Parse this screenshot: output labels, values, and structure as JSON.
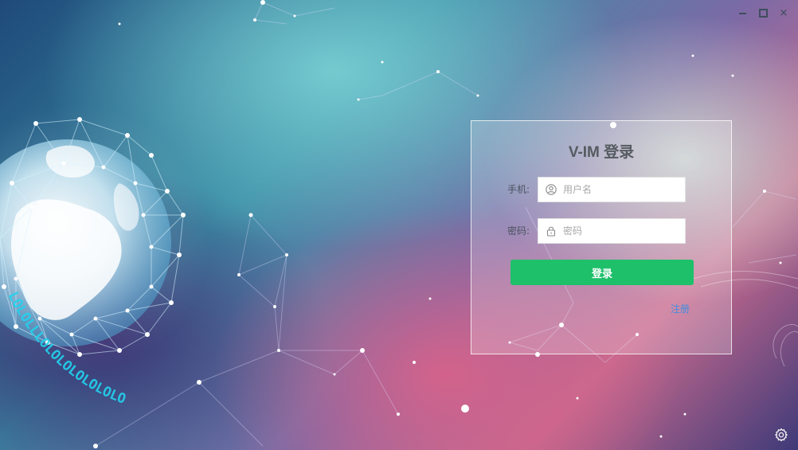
{
  "window": {
    "controls": {
      "minimize_icon": "minimize-icon",
      "maximize_icon": "maximize-icon",
      "close_symbol": "×"
    }
  },
  "login": {
    "title": "V-IM 登录",
    "phone_label": "手机:",
    "phone_placeholder": "用户名",
    "phone_value": "",
    "password_label": "密码:",
    "password_placeholder": "密码",
    "password_value": "",
    "submit_label": "登录",
    "register_label": "注册"
  },
  "background": {
    "binary_text": "LOLOLLLOLOLOLOLOLOLO"
  },
  "colors": {
    "accent_green": "#1ec06a",
    "link_blue": "#3f8fe0",
    "title_gray": "#555b60"
  },
  "icons": {
    "user": "user-icon",
    "lock": "lock-icon",
    "settings": "gear-icon"
  }
}
